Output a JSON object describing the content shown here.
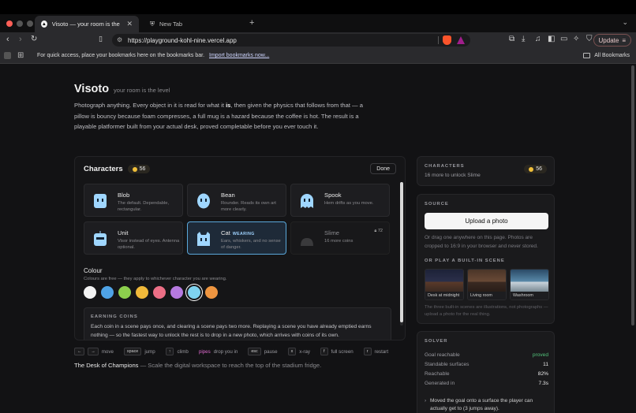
{
  "browser": {
    "tabs": [
      {
        "title": "Visoto — your room is the level",
        "favicon": "▲"
      },
      {
        "title": "New Tab",
        "favicon": "shield"
      }
    ],
    "url": "https://playground-kohl-nine.vercel.app",
    "update_label": "Update",
    "bookmarks_message": "For quick access, place your bookmarks here on the bookmarks bar.",
    "import_link": "Import bookmarks now...",
    "all_bookmarks": "All Bookmarks"
  },
  "hero": {
    "title": "Visoto",
    "tagline": "your room is the level",
    "intro_pre": "Photograph anything. Every object in it is read for what it ",
    "intro_bold": "is",
    "intro_post": ", then given the physics that follows from that — a pillow is bouncy because foam compresses, a full mug is a hazard because the coffee is hot. The result is a playable platformer built from your actual desk, proved completable before you ever touch it."
  },
  "characters": {
    "heading": "Characters",
    "coins": "56",
    "done_label": "Done",
    "items": [
      {
        "name": "Blob",
        "desc": "The default. Dependable, rectangular.",
        "color": "#9fd6ff"
      },
      {
        "name": "Bean",
        "desc": "Rounder. Reads its own art more clearly.",
        "color": "#9fd6ff"
      },
      {
        "name": "Spook",
        "desc": "Hem drifts as you move.",
        "color": "#9fd6ff"
      },
      {
        "name": "Unit",
        "desc": "Visor instead of eyes. Antenna optional.",
        "color": "#9fd6ff"
      },
      {
        "name": "Cat",
        "badge": "WEARING",
        "desc": "Ears, whiskers, and no sense of danger.",
        "color": "#9fd6ff"
      },
      {
        "name": "Slime",
        "desc": "16 more coins",
        "lock_cost": "72",
        "color": "#444"
      }
    ],
    "colour_heading": "Colour",
    "colour_sub": "Colours are free — they apply to whichever character you are wearing.",
    "swatches": [
      "#f2f2f2",
      "#4fa3e6",
      "#8ccf4d",
      "#f0b93a",
      "#ec6f86",
      "#b67ae0",
      "#7fd3f0",
      "#ee9540"
    ],
    "selected_swatch": 6,
    "earning_heading": "EARNING COINS",
    "earning_body": "Each coin in a scene pays once, and clearing a scene pays two more. Replaying a scene you have already emptied earns nothing — so the fastest way to unlock the rest is to drop in a new photo, which arrives with coins of its own."
  },
  "hints": [
    {
      "keys": [
        "←",
        "→"
      ],
      "label": "move"
    },
    {
      "keys": [
        "space"
      ],
      "label": "jump"
    },
    {
      "keys": [
        "↑"
      ],
      "label": "climb"
    },
    {
      "keys": [],
      "label_pre": "pipes",
      "label": "drop you in"
    },
    {
      "keys": [
        "esc"
      ],
      "label": "pause"
    },
    {
      "keys": [
        "x"
      ],
      "label": "x-ray"
    },
    {
      "keys": [
        "f"
      ],
      "label": "full screen"
    },
    {
      "keys": [
        "r"
      ],
      "label": "restart"
    }
  ],
  "footer": {
    "title": "The Desk of Champions",
    "desc": "— Scale the digital workspace to reach the top of the stadium fridge."
  },
  "side_characters": {
    "label": "CHARACTERS",
    "sub": "16 more to unlock Slime",
    "coins": "56"
  },
  "source": {
    "label": "SOURCE",
    "upload_label": "Upload a photo",
    "drag_text": "Or drag one anywhere on this page. Photos are cropped to 16:9 in your browser and never stored.",
    "builtin_label": "OR PLAY A BUILT-IN SCENE",
    "scenes": [
      {
        "name": "Desk at midnight"
      },
      {
        "name": "Living room"
      },
      {
        "name": "Washroom"
      }
    ],
    "disclaimer": "The three built-in scenes are illustrations, not photographs — upload a photo for the real thing."
  },
  "solver": {
    "label": "SOLVER",
    "rows": [
      {
        "k": "Goal reachable",
        "v": "proved"
      },
      {
        "k": "Standable surfaces",
        "v": "11"
      },
      {
        "k": "Reachable",
        "v": "82%"
      },
      {
        "k": "Generated in",
        "v": "7.3s"
      }
    ],
    "note": "Moved the goal onto a surface the player can actually get to (3 jumps away)."
  }
}
